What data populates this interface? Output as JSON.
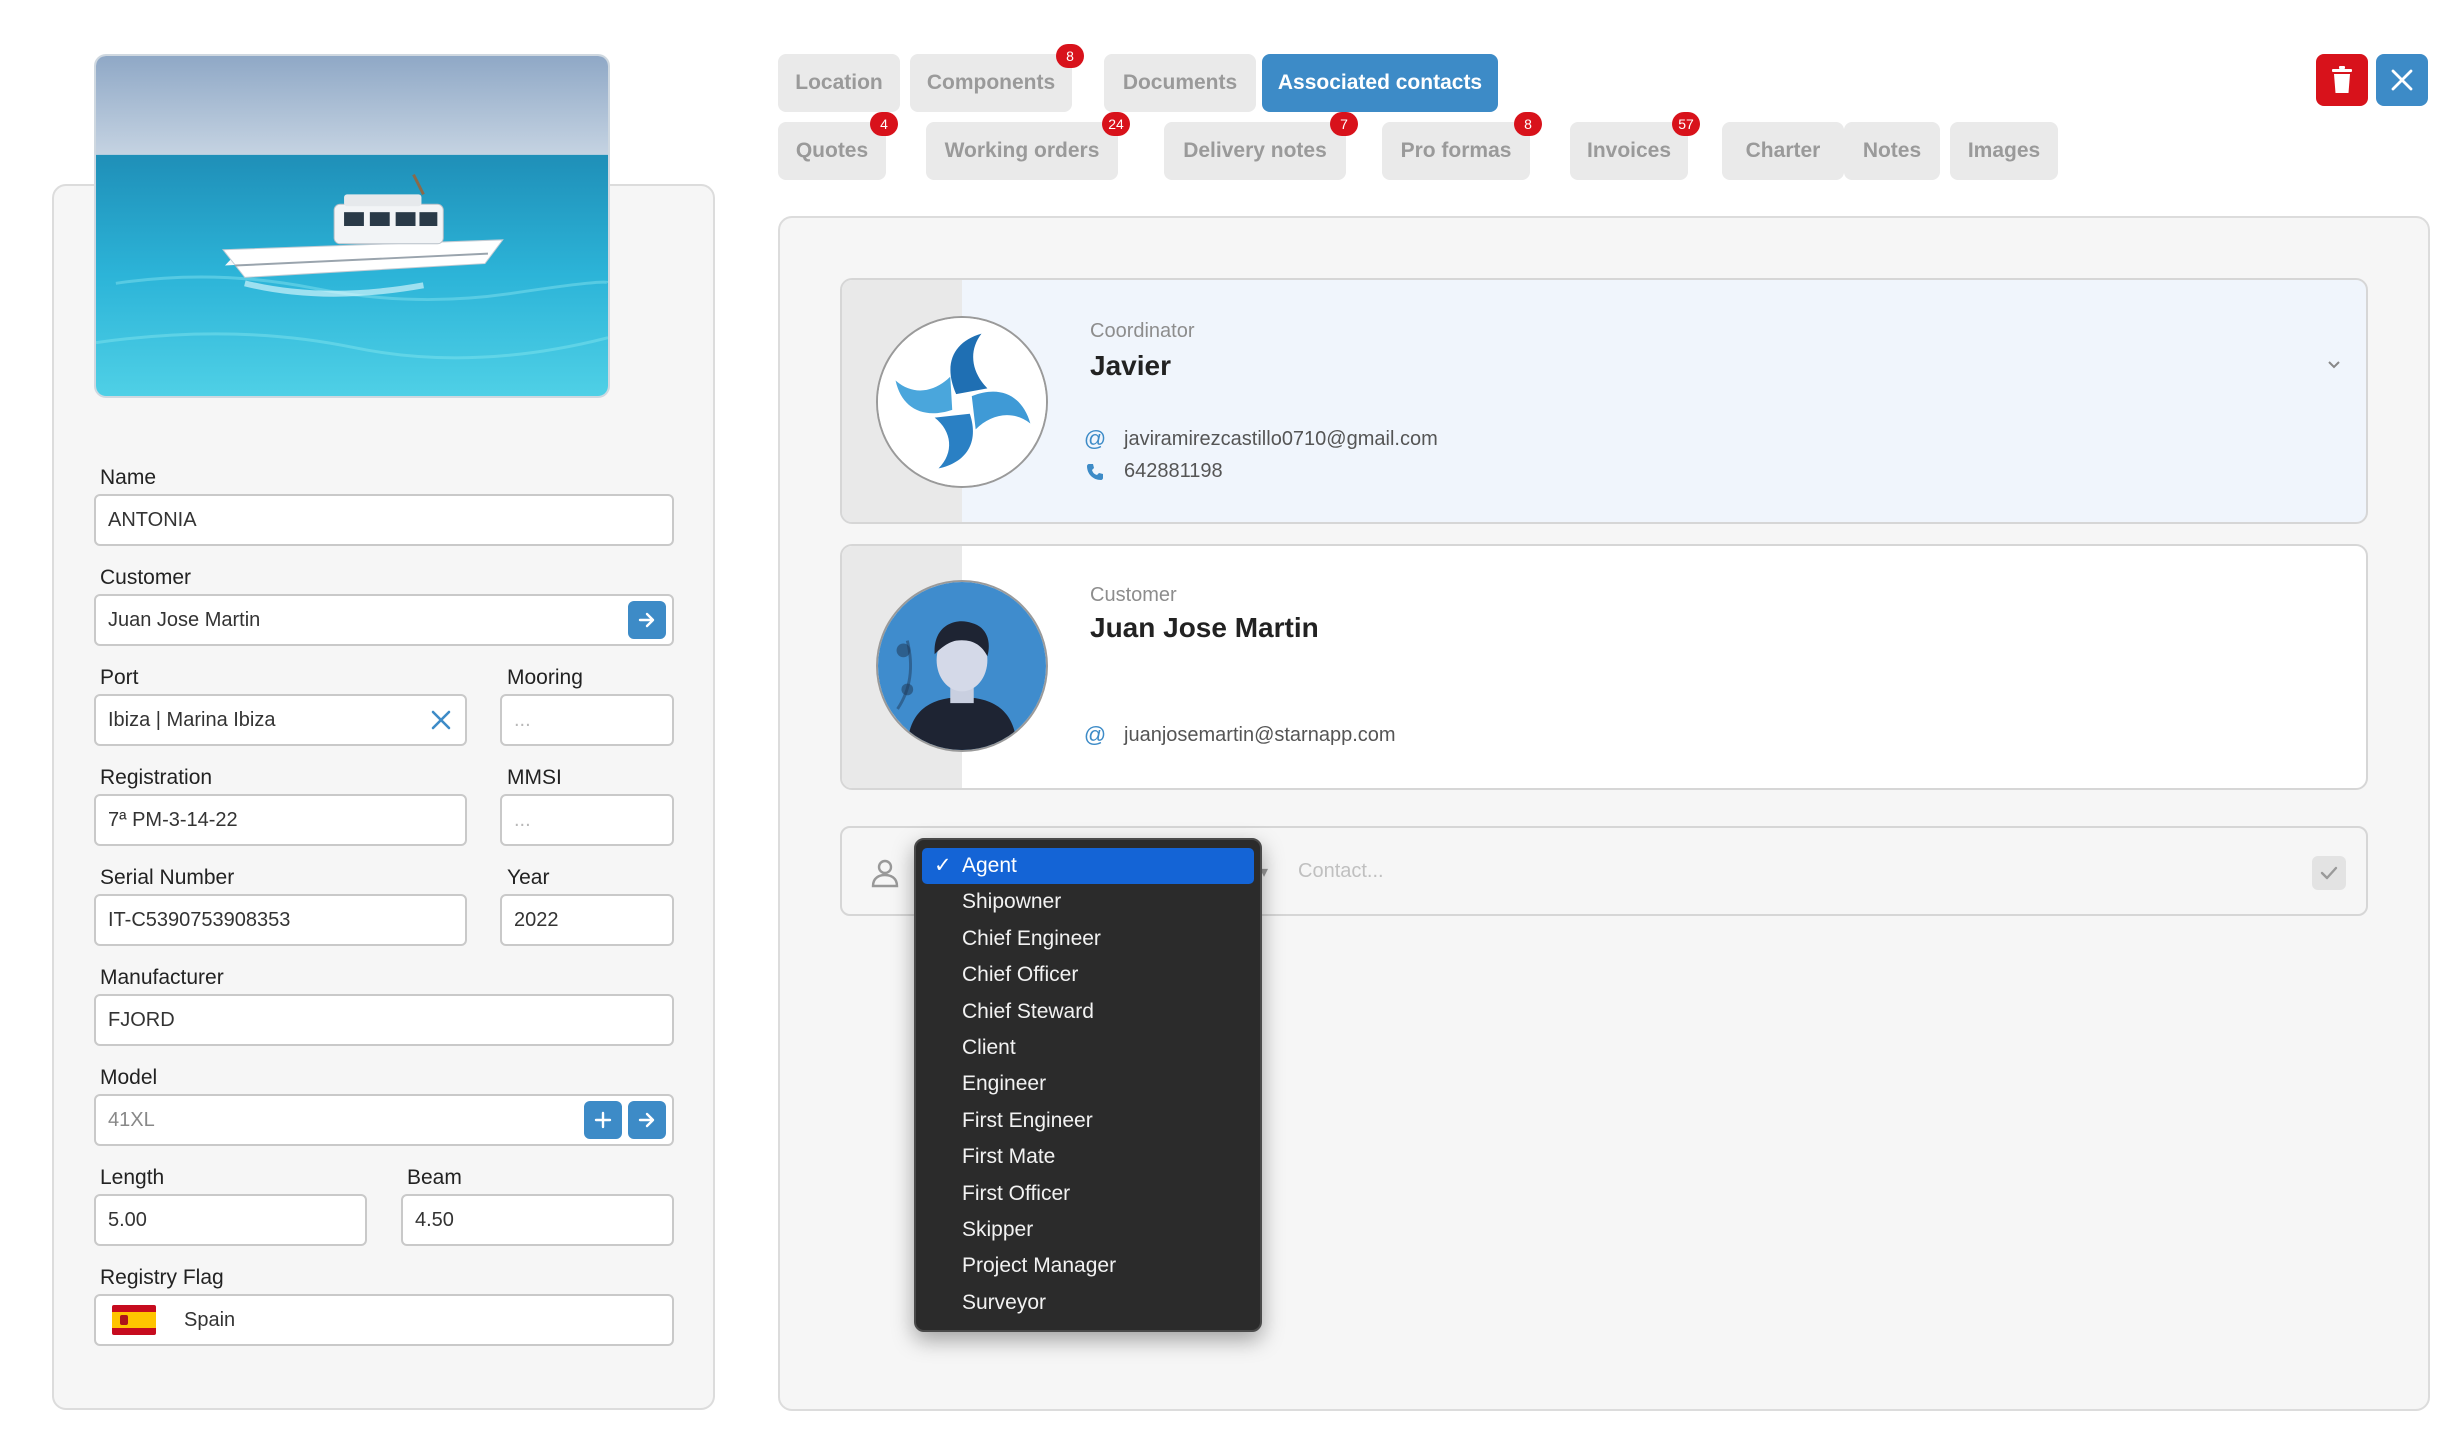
{
  "vessel": {
    "photo_alt": "boat-photo",
    "name_label": "Name",
    "name_value": "ANTONIA",
    "customer_label": "Customer",
    "customer_value": "Juan Jose Martin",
    "port_label": "Port",
    "port_value": "Ibiza | Marina Ibiza",
    "mooring_label": "Mooring",
    "mooring_placeholder": "...",
    "registration_label": "Registration",
    "registration_value": "7ª PM-3-14-22",
    "mmsi_label": "MMSI",
    "mmsi_placeholder": "...",
    "serial_label": "Serial Number",
    "serial_value": "IT-C5390753908353",
    "year_label": "Year",
    "year_value": "2022",
    "manufacturer_label": "Manufacturer",
    "manufacturer_value": "FJORD",
    "model_label": "Model",
    "model_value": "41XL",
    "length_label": "Length",
    "length_value": "5.00",
    "beam_label": "Beam",
    "beam_value": "4.50",
    "flag_label": "Registry Flag",
    "flag_value": "Spain"
  },
  "tabs": {
    "row1": [
      {
        "label": "Location",
        "badge": null,
        "active": false
      },
      {
        "label": "Components",
        "badge": "8",
        "active": false
      },
      {
        "label": "Documents",
        "badge": null,
        "active": false
      },
      {
        "label": "Associated contacts",
        "badge": null,
        "active": true
      }
    ],
    "row2": [
      {
        "label": "Quotes",
        "badge": "4"
      },
      {
        "label": "Working orders",
        "badge": "24"
      },
      {
        "label": "Delivery notes",
        "badge": "7"
      },
      {
        "label": "Pro formas",
        "badge": "8"
      },
      {
        "label": "Invoices",
        "badge": "57"
      },
      {
        "label": "Charter",
        "badge": null
      },
      {
        "label": "Notes",
        "badge": null
      },
      {
        "label": "Images",
        "badge": null
      }
    ]
  },
  "actions": {
    "delete_icon": "trash-icon",
    "close_icon": "close-icon",
    "delete_color": "#d8121b",
    "close_color": "#3d8bc7"
  },
  "contacts": [
    {
      "role": "Coordinator",
      "name": "Javier",
      "email": "javiramirezcastillo0710@gmail.com",
      "phone": "642881198",
      "avatar": "starfish-logo"
    },
    {
      "role": "Customer",
      "name": "Juan Jose Martin",
      "email": "juanjosemartin@starnapp.com",
      "avatar": "person-illustration"
    }
  ],
  "new_contact": {
    "contact_placeholder": "Contact..."
  },
  "role_dropdown": {
    "selected": "Agent",
    "options": [
      "Agent",
      "Shipowner",
      "Chief Engineer",
      "Chief Officer",
      "Chief Steward",
      "Client",
      "Engineer",
      "First Engineer",
      "First Mate",
      "First Officer",
      "Skipper",
      "Project Manager",
      "Surveyor"
    ]
  },
  "colors": {
    "accent": "#3d8bc7",
    "badge": "#d8121b",
    "dropdown_bg": "#2b2b2b",
    "dropdown_selected": "#1464d6"
  }
}
